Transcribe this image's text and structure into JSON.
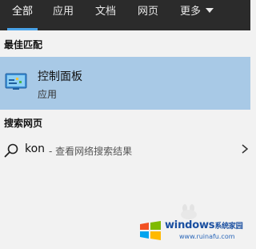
{
  "tabs": [
    {
      "label": "全部",
      "active": true
    },
    {
      "label": "应用",
      "active": false
    },
    {
      "label": "文档",
      "active": false
    },
    {
      "label": "网页",
      "active": false
    },
    {
      "label": "更多",
      "active": false,
      "icon": "chevron-down-icon"
    }
  ],
  "best_match": {
    "header": "最佳匹配",
    "title": "控制面板",
    "subtitle": "应用",
    "icon": "control-panel-icon",
    "highlight_color": "#a8c9e6"
  },
  "web_search": {
    "header": "搜索网页",
    "query": "kon",
    "suffix": " - 查看网络搜索结果",
    "icon": "search-icon",
    "arrow_icon": "chevron-right-icon"
  },
  "watermark": {
    "text": "windows",
    "subtext": "系统家园",
    "url": "www.ruinafu.com"
  },
  "colors": {
    "tabbar_bg": "#2b2b2b",
    "tab_underline": "#4aa3e8",
    "panel_bg": "#f2f2f2"
  }
}
